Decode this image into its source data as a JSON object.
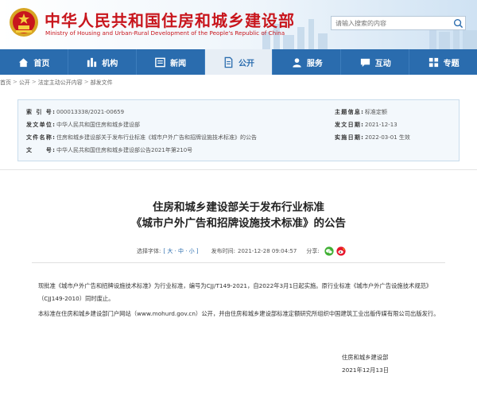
{
  "header": {
    "title": "中华人民共和国住房和城乡建设部",
    "subtitle": "Ministry of Housing and Urban-Rural Development of the People's Republic of China",
    "search_placeholder": "请输入搜索的内容",
    "brand_red": "#c8161d",
    "brand_blue": "#2a6cae"
  },
  "nav": {
    "items": [
      {
        "label": "首页",
        "icon": "home-icon"
      },
      {
        "label": "机构",
        "icon": "building-icon"
      },
      {
        "label": "新闻",
        "icon": "newspaper-icon"
      },
      {
        "label": "公开",
        "icon": "document-icon",
        "active": true
      },
      {
        "label": "服务",
        "icon": "service-icon"
      },
      {
        "label": "互动",
        "icon": "chat-icon"
      },
      {
        "label": "专题",
        "icon": "topic-icon"
      }
    ]
  },
  "breadcrumb": {
    "items": [
      "首页",
      "公开",
      "法定主动公开内容",
      "部发文件"
    ],
    "separator": ">"
  },
  "info": {
    "index_label": "索 引 号:",
    "index_value": "000013338/2021-00659",
    "issuer_label": "发文单位:",
    "issuer_value": "中华人民共和国住房和城乡建设部",
    "filename_label": "文件名称:",
    "filename_value": "住房和城乡建设部关于发布行业标准《城市户外广告和招牌设施技术标准》的公告",
    "doc_label": "文　　号:",
    "doc_value": "中华人民共和国住房和城乡建设部公告2021年第210号",
    "topic_label": "主题信息:",
    "topic_value": "标准定额",
    "date_label": "发文日期:",
    "date_value": "2021-12-13",
    "status_label": "实施日期:",
    "status_value": "2022-03-01 生效"
  },
  "article": {
    "title_line1": "住房和城乡建设部关于发布行业标准",
    "title_line2": "《城市户外广告和招牌设施技术标准》的公告",
    "font_label": "选择字体:",
    "font_sizes": "[ 大 · 中 · 小 ]",
    "publish_label": "发布时间:",
    "publish_time": "2021-12-28 09:04:57",
    "share_label": "分享:",
    "para1": "现批准《城市户外广告和招牌设施技术标准》为行业标准，编号为CJJ/T149-2021，自2022年3月1日起实施。原行业标准《城市户外广告设施技术规范》（CJJ149-2010）同时废止。",
    "para2": "本标准在住房和城乡建设部门户网站（www.mohurd.gov.cn）公开，并由住房和城乡建设部标准定额研究所组织中国建筑工业出版传媒有限公司出版发行。",
    "signature": "住房和城乡建设部",
    "sign_date": "2021年12月13日"
  }
}
